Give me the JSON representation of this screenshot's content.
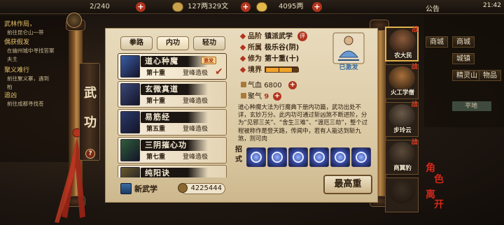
{
  "topbar": {
    "level": "2/240",
    "silver": "127两329文",
    "gold": "4095两",
    "announcement": "公告",
    "time": "21:42"
  },
  "quests": [
    {
      "title": "武林作局，",
      "sub": "前往昆仑山一带"
    },
    {
      "title": "偶获假发",
      "sub": "在幽州城中寻找答案"
    },
    {
      "title": "",
      "sub": "夫主"
    },
    {
      "title": "聚义难行",
      "sub": "前往聚义寨，遇到"
    },
    {
      "title": "",
      "sub": "柏"
    },
    {
      "title": "追凶",
      "sub": "前往成都寻找苍"
    }
  ],
  "panel": {
    "title_chars": [
      "武",
      "功"
    ],
    "help": "?",
    "tabs": [
      "拳路",
      "内功",
      "轻功"
    ]
  },
  "skills": [
    {
      "name": "道心种魔",
      "layer": "第十重",
      "level": "登峰造极",
      "active_badge": "激发",
      "book_color": "#3a5ea8"
    },
    {
      "name": "玄微真道",
      "layer": "第十重",
      "level": "登峰造极",
      "active_badge": "",
      "book_color": "#3a4878"
    },
    {
      "name": "易筋经",
      "layer": "第五重",
      "level": "登峰造极",
      "active_badge": "",
      "book_color": "#2a3a6a"
    },
    {
      "name": "三阴摧心功",
      "layer": "第七重",
      "level": "登峰造极",
      "active_badge": "",
      "book_color": "#2f5e3a"
    },
    {
      "name": "纯阳诀",
      "layer": "",
      "level": "",
      "active_badge": "",
      "book_color": "#6a5a2a"
    }
  ],
  "footer": {
    "new_skill": "新武学",
    "points": "4225444"
  },
  "detail": {
    "attrs": [
      {
        "key": "品阶",
        "value": "镇派武学"
      },
      {
        "key": "所属",
        "value": "极乐谷(阴)"
      },
      {
        "key": "修为",
        "value": "第十重(十)"
      },
      {
        "key": "境界",
        "value": ""
      }
    ],
    "eval_badge": "评",
    "realm_filled": 4,
    "figure_label": "已激发",
    "stats": [
      {
        "key": "气血",
        "value": "6800",
        "red": false
      },
      {
        "key": "聚气",
        "value": "9",
        "red": true
      }
    ],
    "description": "道心种魔大法为行魔典下册内功篇，武功出处不详，玄妙万分。此内功可通过斩凶煞不断进阶，分为“见邪三关”、“舍生三难”、“渡厄三劫”，整个过程被称作是登天路，传闻中，若有人能达到斩九煞，则可肉",
    "moves_label": "招式",
    "max_button": "最高重"
  },
  "party": [
    {
      "name": "农大民",
      "tag": "战",
      "face": "#8b5a3a"
    },
    {
      "name": "火工学僧",
      "tag": "战",
      "face": "#a8703a"
    },
    {
      "name": "步玲云",
      "tag": "战",
      "face": "#6a5a4a"
    },
    {
      "name": "商翼豹",
      "tag": "战",
      "face": "#5a4a3a"
    },
    {
      "name": "",
      "tag": "",
      "face": "#3a2e22"
    }
  ],
  "map": {
    "buttons": [
      "商城",
      "商城",
      "城镇",
      "精灵山",
      "物品"
    ],
    "location": "平地"
  },
  "role_stamp": [
    "角",
    "色",
    "离",
    "开"
  ]
}
